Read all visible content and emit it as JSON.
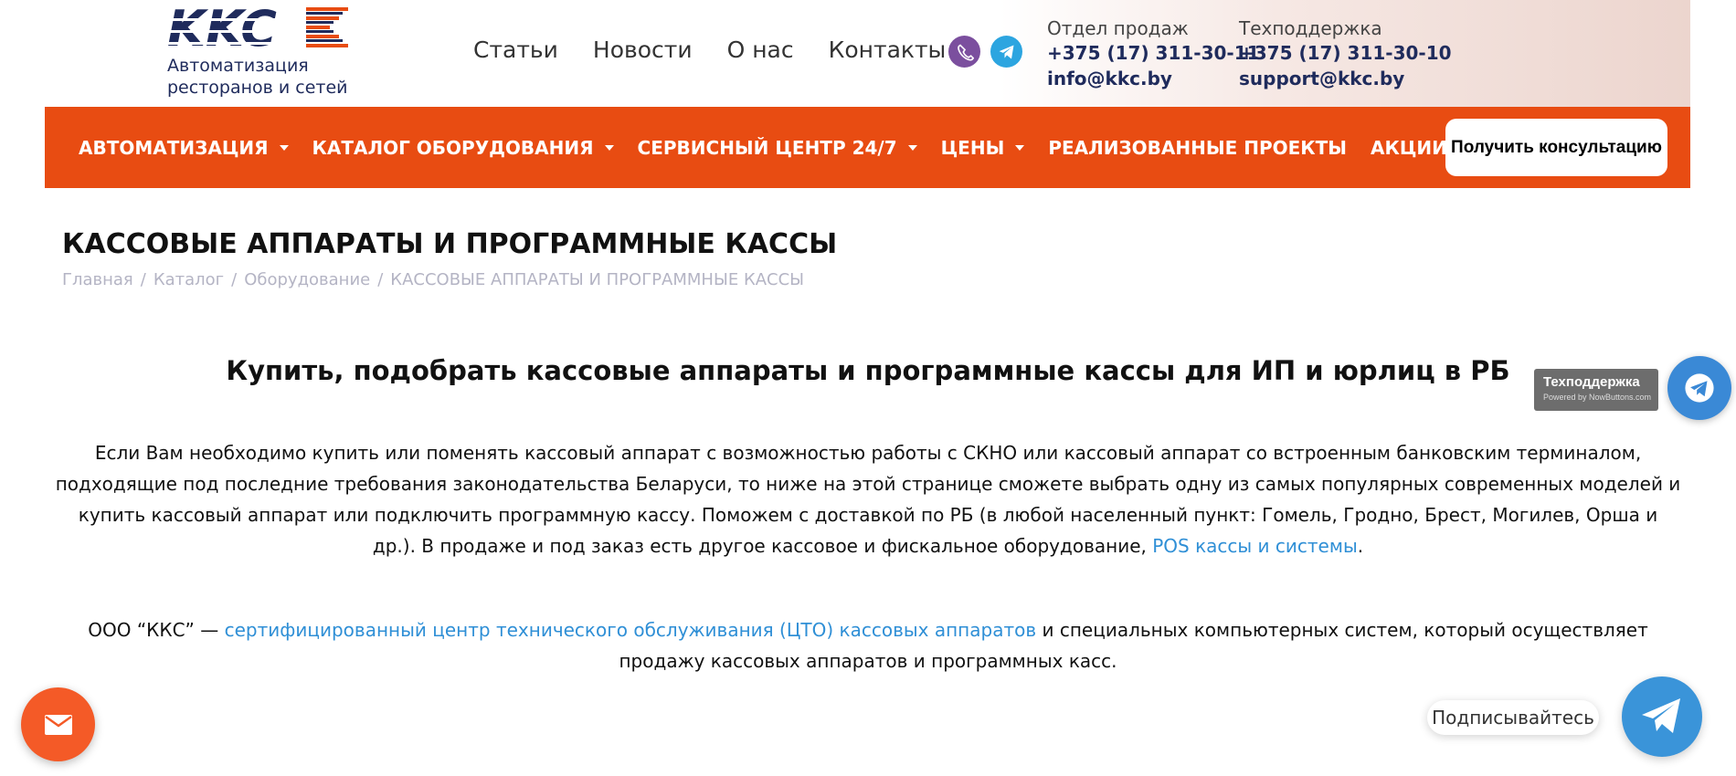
{
  "header": {
    "logo_tagline": "Автоматизация ресторанов и сетей",
    "top_nav": [
      "Статьи",
      "Новости",
      "О нас",
      "Контакты"
    ],
    "sales": {
      "title": "Отдел продаж",
      "phone": "+375 (17) 311-30-11",
      "email": "info@kkc.by"
    },
    "support": {
      "title": "Техподдержка",
      "phone": "+375 (17) 311-30-10",
      "email": "support@kkc.by"
    }
  },
  "main_nav": {
    "items": [
      {
        "label": "АВТОМАТИЗАЦИЯ",
        "dropdown": true
      },
      {
        "label": "КАТАЛОГ ОБОРУДОВАНИЯ",
        "dropdown": true
      },
      {
        "label": "СЕРВИСНЫЙ ЦЕНТР 24/7",
        "dropdown": true
      },
      {
        "label": "ЦЕНЫ",
        "dropdown": true
      },
      {
        "label": "РЕАЛИЗОВАННЫЕ ПРОЕКТЫ",
        "dropdown": false
      },
      {
        "label": "АКЦИИ",
        "dropdown": false
      }
    ],
    "consult_button": "Получить консультацию"
  },
  "page": {
    "title": "КАССОВЫЕ АППАРАТЫ И ПРОГРАММНЫЕ КАССЫ",
    "breadcrumb": [
      "Главная",
      "Каталог",
      "Оборудование",
      "КАССОВЫЕ АППАРАТЫ И ПРОГРАММНЫЕ КАССЫ"
    ],
    "heading": "Купить, подобрать кассовые аппараты и программные кассы для ИП и юрлиц в РБ",
    "para1_text": "Если Вам необходимо купить или поменять кассовый аппарат с возможностью работы с СКНО или кассовый аппарат со встроенным банковским терминалом, подходящие под последние требования законодательства Беларуси,  то ниже на этой странице сможете выбрать одну из самых популярных современных моделей и купить кассовый аппарат или подключить программную кассу.  Поможем с доставкой по РБ (в любой населенный пункт: Гомель, Гродно, Брест, Могилев, Орша и др.). В продаже и под заказ есть другое кассовое и фискальное оборудование, ",
    "para1_link": "POS кассы и системы",
    "para1_end": ".",
    "para2_start": "ООО “ККС” — ",
    "para2_link": "сертифицированный центр технического обслуживания (ЦТО) кассовых аппаратов",
    "para2_end": " и специальных компьютерных систем, который осуществляет продажу кассовых аппаратов и программных касс."
  },
  "widgets": {
    "tech_badge_title": "Техподдержка",
    "tech_badge_sub": "Powered by NowButtons.com",
    "subscribe_label": "Подписывайтесь"
  },
  "colors": {
    "brand_orange": "#e84c12",
    "navy": "#1f2b5c",
    "link": "#2f8fd6"
  }
}
